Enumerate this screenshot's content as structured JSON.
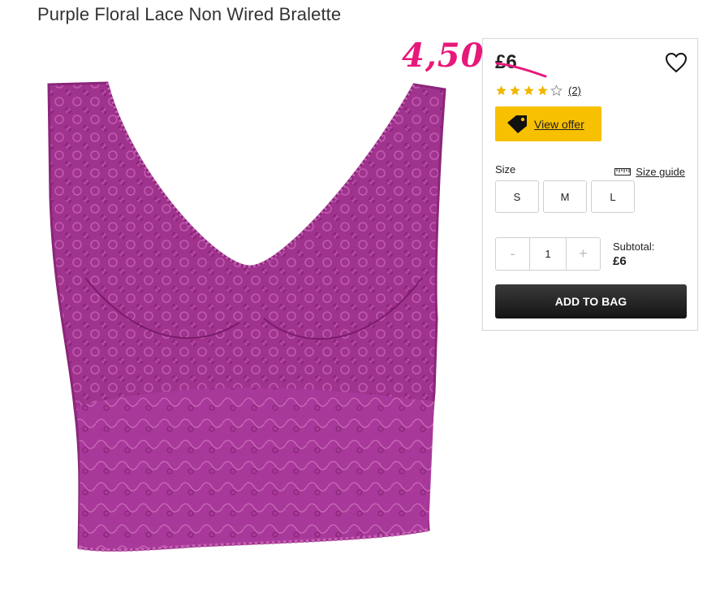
{
  "product": {
    "title": "Purple Floral Lace Non Wired Bralette",
    "price": "£6",
    "annotated_price": "4,50",
    "rating_value": 4,
    "rating_max": 5,
    "review_count": "(2)",
    "offer_label": "View offer",
    "size_label": "Size",
    "size_guide_label": "Size guide",
    "sizes": [
      "S",
      "M",
      "L"
    ],
    "quantity": "1",
    "qty_minus": "-",
    "qty_plus": "+",
    "subtotal_label": "Subtotal:",
    "subtotal_value": "£6",
    "add_to_bag": "ADD TO BAG"
  },
  "colors": {
    "product": "#9e2f8a",
    "offer": "#f7c000",
    "annotation": "#e8187a",
    "star": "#f2b600"
  },
  "icons": [
    "heart-icon",
    "star-icon",
    "price-tag-icon",
    "ruler-icon"
  ]
}
